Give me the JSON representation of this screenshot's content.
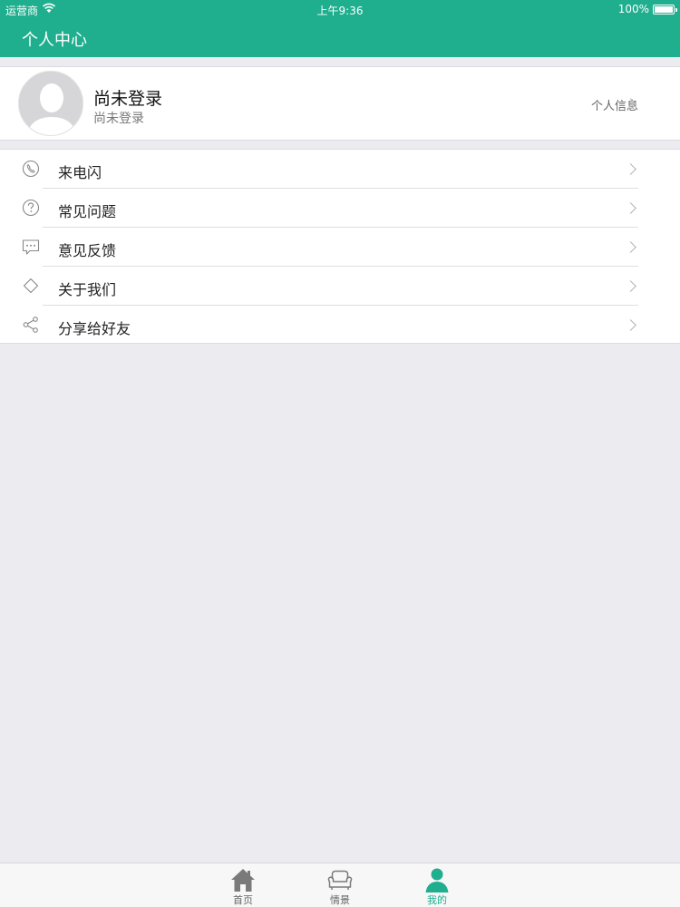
{
  "status_bar": {
    "carrier": "运营商",
    "time": "上午9:36",
    "battery": "100%"
  },
  "nav": {
    "title": "个人中心"
  },
  "profile": {
    "name": "尚未登录",
    "subtitle": "尚未登录",
    "link_label": "个人信息"
  },
  "menu": {
    "items": [
      {
        "label": "来电闪",
        "icon": "phone-icon"
      },
      {
        "label": "常见问题",
        "icon": "question-icon"
      },
      {
        "label": "意见反馈",
        "icon": "feedback-icon"
      },
      {
        "label": "关于我们",
        "icon": "diamond-icon"
      },
      {
        "label": "分享给好友",
        "icon": "share-icon"
      }
    ]
  },
  "tabs": {
    "items": [
      {
        "label": "首页",
        "icon": "home-icon"
      },
      {
        "label": "情景",
        "icon": "sofa-icon"
      },
      {
        "label": "我的",
        "icon": "person-icon"
      }
    ],
    "active_index": 2
  },
  "colors": {
    "accent": "#1fae8e",
    "background": "#ebebf0",
    "inactive_tab": "#7a7a7a"
  }
}
